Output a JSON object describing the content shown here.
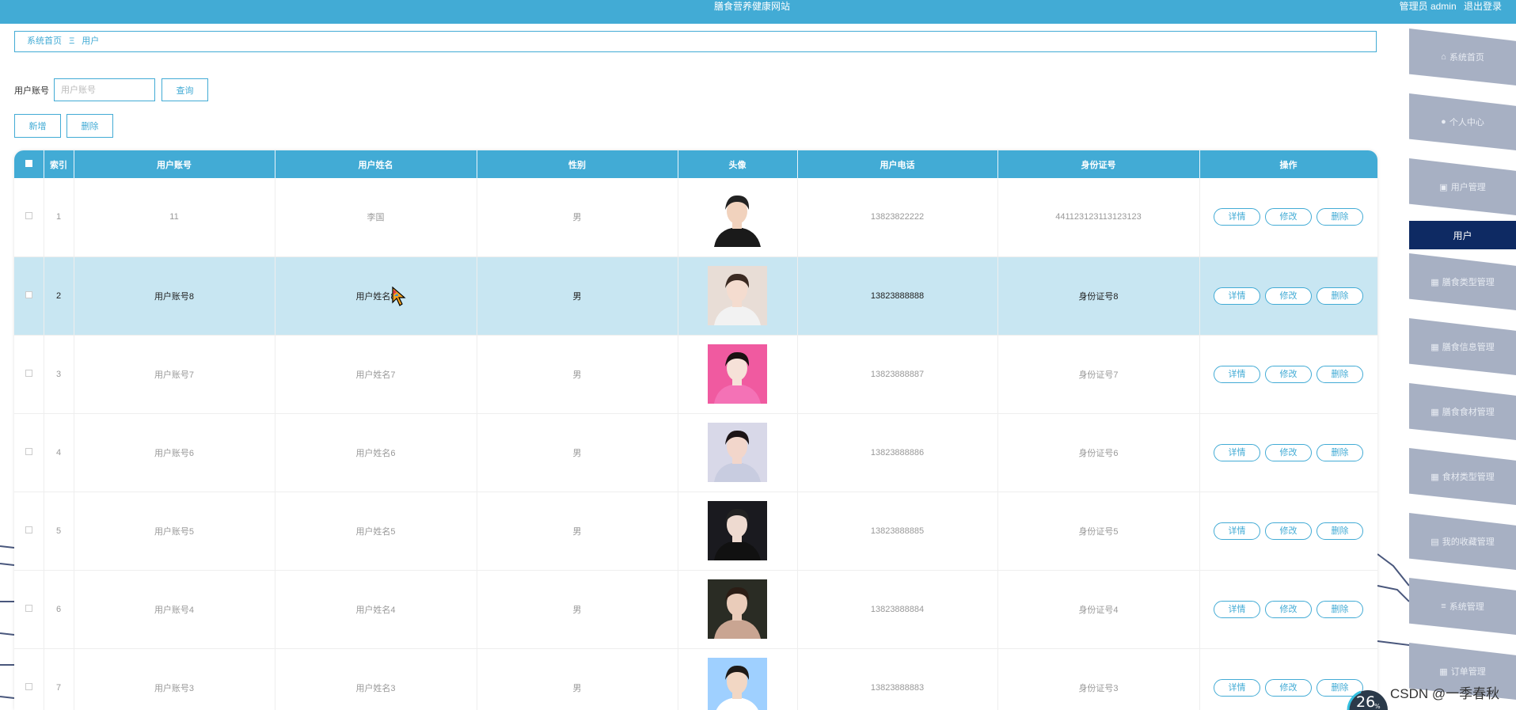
{
  "header": {
    "site_title": "膳食营养健康网站",
    "user_label": "管理员 admin",
    "logout": "退出登录"
  },
  "breadcrumb": {
    "home": "系统首页",
    "separator": "Ξ",
    "current": "用户"
  },
  "search": {
    "label": "用户账号",
    "placeholder": "用户账号",
    "value": "",
    "button": "查询"
  },
  "actions": {
    "add": "新增",
    "delete": "删除"
  },
  "table": {
    "columns": [
      "索引",
      "用户账号",
      "用户姓名",
      "性别",
      "头像",
      "用户电话",
      "身份证号",
      "操作"
    ],
    "row_actions": {
      "detail": "详情",
      "edit": "修改",
      "delete": "删除"
    },
    "rows": [
      {
        "index": "1",
        "account": "11",
        "name": "李国",
        "gender": "男",
        "phone": "13823822222",
        "id_card": "441123123113123123"
      },
      {
        "index": "2",
        "account": "用户账号8",
        "name": "用户姓名8",
        "gender": "男",
        "phone": "13823888888",
        "id_card": "身份证号8"
      },
      {
        "index": "3",
        "account": "用户账号7",
        "name": "用户姓名7",
        "gender": "男",
        "phone": "13823888887",
        "id_card": "身份证号7"
      },
      {
        "index": "4",
        "account": "用户账号6",
        "name": "用户姓名6",
        "gender": "男",
        "phone": "13823888886",
        "id_card": "身份证号6"
      },
      {
        "index": "5",
        "account": "用户账号5",
        "name": "用户姓名5",
        "gender": "男",
        "phone": "13823888885",
        "id_card": "身份证号5"
      },
      {
        "index": "6",
        "account": "用户账号4",
        "name": "用户姓名4",
        "gender": "男",
        "phone": "13823888884",
        "id_card": "身份证号4"
      },
      {
        "index": "7",
        "account": "用户账号3",
        "name": "用户姓名3",
        "gender": "男",
        "phone": "13823888883",
        "id_card": "身份证号3"
      }
    ]
  },
  "sidebar": {
    "items": [
      {
        "label": "系统首页",
        "icon": "home-icon"
      },
      {
        "label": "个人中心",
        "icon": "person-icon"
      },
      {
        "label": "用户管理",
        "icon": "briefcase-icon"
      },
      {
        "label": "膳食类型管理",
        "icon": "grid-icon"
      },
      {
        "label": "膳食信息管理",
        "icon": "grid-icon"
      },
      {
        "label": "膳食食材管理",
        "icon": "grid-icon"
      },
      {
        "label": "食材类型管理",
        "icon": "grid-icon"
      },
      {
        "label": "我的收藏管理",
        "icon": "clipboard-icon"
      },
      {
        "label": "系统管理",
        "icon": "list-icon"
      },
      {
        "label": "订单管理",
        "icon": "table-icon"
      }
    ],
    "active": "用户"
  },
  "overlay": {
    "gauge": "26",
    "gauge_unit": "%",
    "watermark": "CSDN @一季春秋"
  },
  "colors": {
    "accent": "#42abd5",
    "sidebar": "#a7b0c3",
    "active_nav": "#0e2a63",
    "selected_row": "#c8e6f2"
  }
}
